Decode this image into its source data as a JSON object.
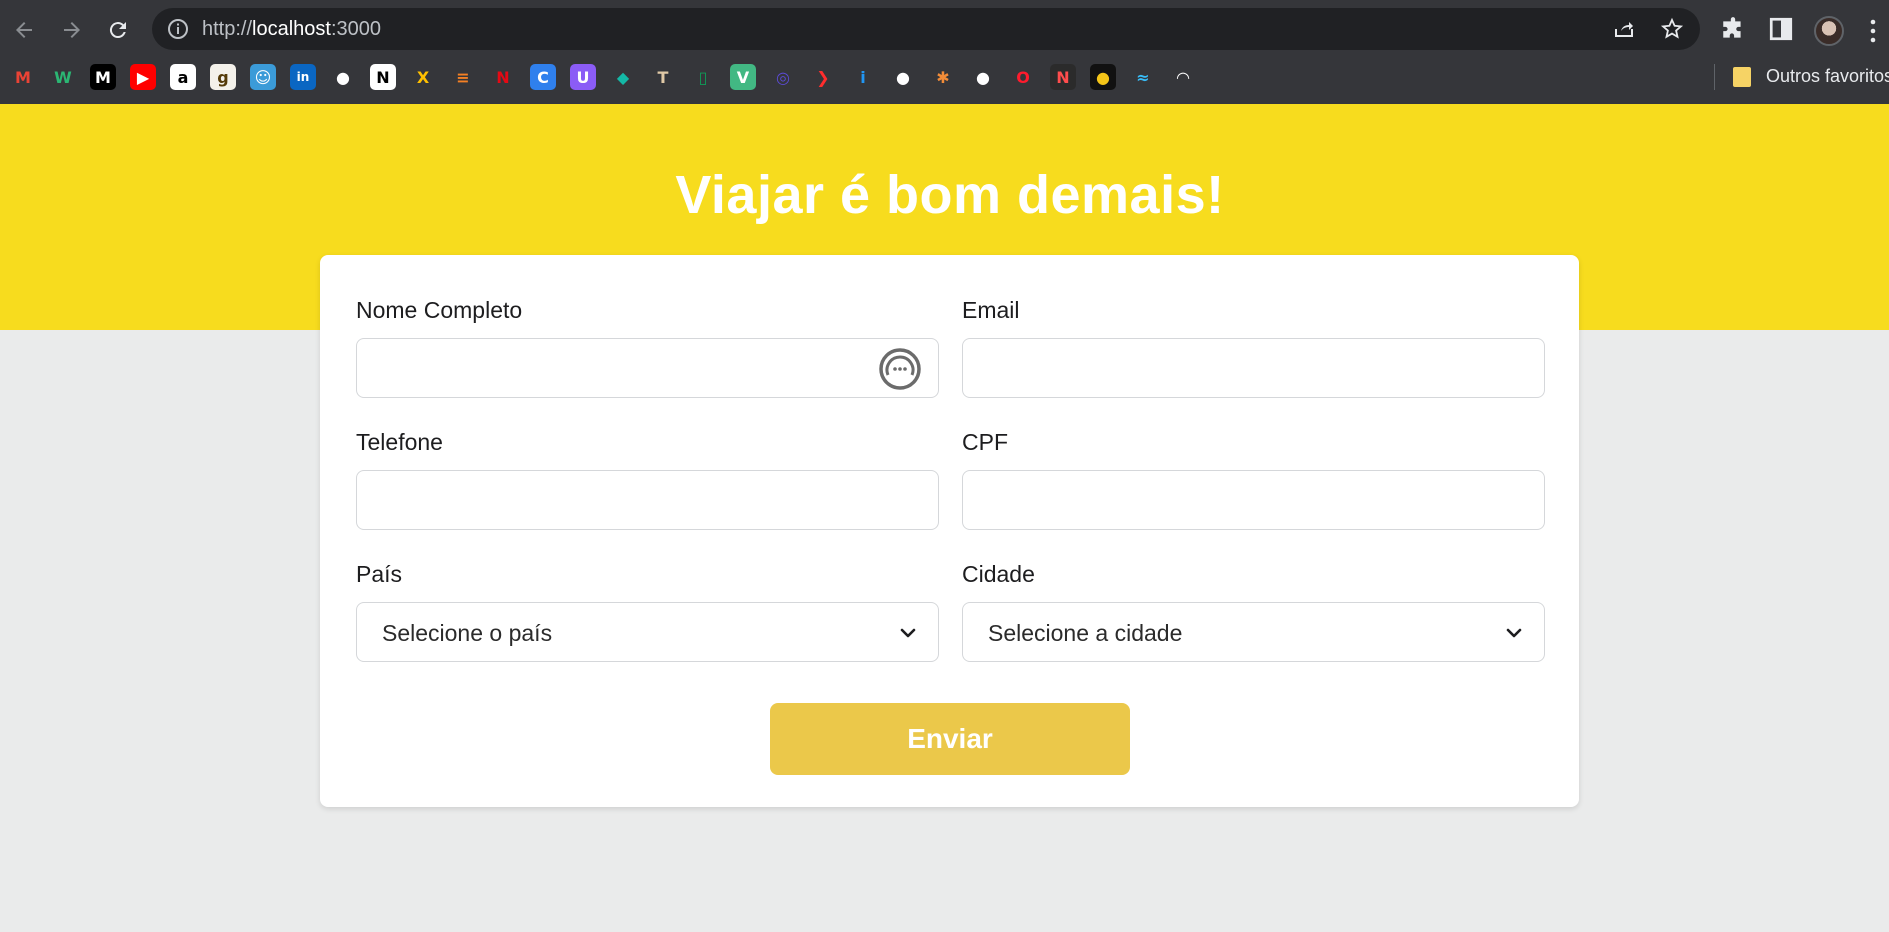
{
  "browser": {
    "url_scheme": "http://",
    "url_host": "localhost",
    "url_port": ":3000",
    "bookmarks_folder_label": "Outros favoritos",
    "bookmarks": [
      {
        "icon": "gmail-icon",
        "glyph": "M",
        "color": "#ea4335",
        "bg": "transparent"
      },
      {
        "icon": "w-app-icon",
        "glyph": "W",
        "color": "#2bb673",
        "bg": "transparent"
      },
      {
        "icon": "medium-icon",
        "glyph": "M",
        "color": "#ffffff",
        "bg": "#000000"
      },
      {
        "icon": "youtube-icon",
        "glyph": "▶",
        "color": "#ffffff",
        "bg": "#ff0000"
      },
      {
        "icon": "amazon-icon",
        "glyph": "a",
        "color": "#000000",
        "bg": "#ffffff"
      },
      {
        "icon": "goodreads-icon",
        "glyph": "g",
        "color": "#553b08",
        "bg": "#f4f1ea"
      },
      {
        "icon": "face-app-icon",
        "glyph": "☺",
        "color": "#ffffff",
        "bg": "#3b9bd8"
      },
      {
        "icon": "linkedin-icon",
        "glyph": "in",
        "color": "#ffffff",
        "bg": "#0a66c2"
      },
      {
        "icon": "github-icon",
        "glyph": "●",
        "color": "#ffffff",
        "bg": "transparent"
      },
      {
        "icon": "notion-icon",
        "glyph": "N",
        "color": "#000000",
        "bg": "#ffffff"
      },
      {
        "icon": "xb-icon",
        "glyph": "X",
        "color": "#ffc000",
        "bg": "transparent"
      },
      {
        "icon": "stackoverflow-icon",
        "glyph": "≡",
        "color": "#f48024",
        "bg": "transparent"
      },
      {
        "icon": "netflix-icon",
        "glyph": "N",
        "color": "#e50914",
        "bg": "transparent"
      },
      {
        "icon": "canva-icon",
        "glyph": "C",
        "color": "#ffffff",
        "bg": "#2f80ed"
      },
      {
        "icon": "u-app-icon",
        "glyph": "U",
        "color": "#ffffff",
        "bg": "#8b5cf6"
      },
      {
        "icon": "diamond-icon",
        "glyph": "◆",
        "color": "#14b8a6",
        "bg": "transparent"
      },
      {
        "icon": "hammer-icon",
        "glyph": "T",
        "color": "#e0c9a6",
        "bg": "transparent"
      },
      {
        "icon": "sheets-icon",
        "glyph": "▯",
        "color": "#0f9d58",
        "bg": "transparent"
      },
      {
        "icon": "vue-icon",
        "glyph": "V",
        "color": "#ffffff",
        "bg": "#42b883"
      },
      {
        "icon": "circle-app-icon",
        "glyph": "◎",
        "color": "#5b4bd6",
        "bg": "transparent"
      },
      {
        "icon": "arrow-app-icon",
        "glyph": "❯",
        "color": "#ff2d2d",
        "bg": "transparent"
      },
      {
        "icon": "info-app-icon",
        "glyph": "i",
        "color": "#2196f3",
        "bg": "transparent"
      },
      {
        "icon": "github-icon",
        "glyph": "●",
        "color": "#ffffff",
        "bg": "transparent"
      },
      {
        "icon": "asterisk-icon",
        "glyph": "✱",
        "color": "#f28c38",
        "bg": "transparent"
      },
      {
        "icon": "github-icon",
        "glyph": "●",
        "color": "#ffffff",
        "bg": "transparent"
      },
      {
        "icon": "opera-icon",
        "glyph": "O",
        "color": "#ff1b2d",
        "bg": "transparent"
      },
      {
        "icon": "nin-icon",
        "glyph": "N",
        "color": "#ff4d4d",
        "bg": "#2b2b2b"
      },
      {
        "icon": "dog-app-icon",
        "glyph": "●",
        "color": "#f5c518",
        "bg": "#111111"
      },
      {
        "icon": "tailwind-icon",
        "glyph": "≈",
        "color": "#38bdf8",
        "bg": "transparent"
      },
      {
        "icon": "gauge-icon",
        "glyph": "◠",
        "color": "#ffffff",
        "bg": "transparent"
      }
    ]
  },
  "page": {
    "title": "Viajar é bom demais!",
    "form": {
      "full_name_label": "Nome Completo",
      "email_label": "Email",
      "phone_label": "Telefone",
      "cpf_label": "CPF",
      "country_label": "País",
      "city_label": "Cidade",
      "country_placeholder": "Selecione o país",
      "city_placeholder": "Selecione a cidade",
      "submit_label": "Enviar"
    }
  }
}
